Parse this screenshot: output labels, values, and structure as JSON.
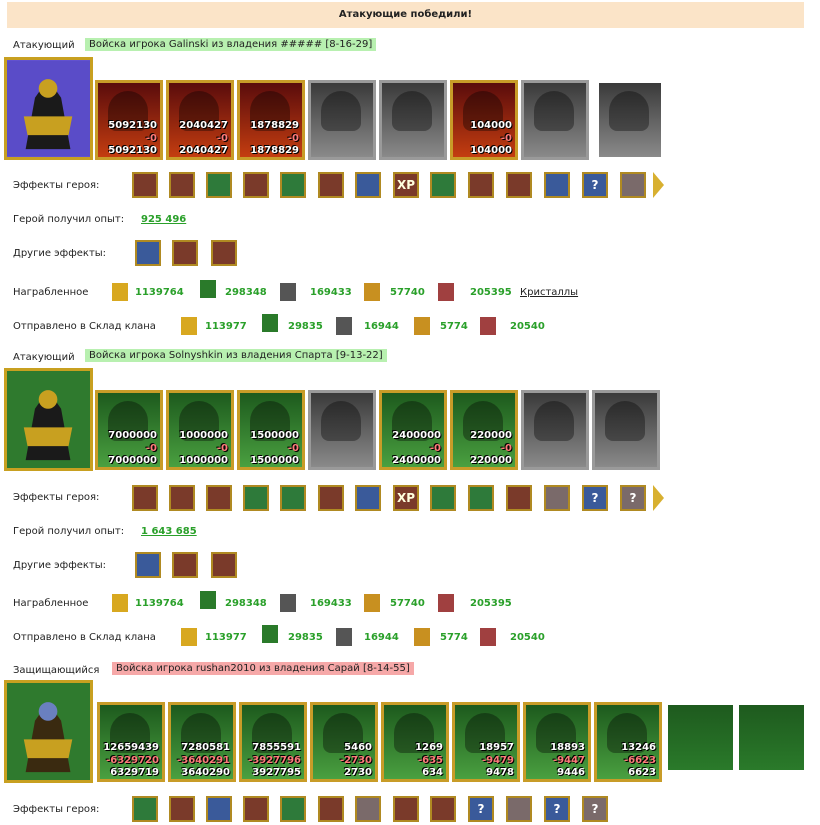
{
  "banner": "Атакующие победили!",
  "sections": [
    {
      "role": "Атакующий",
      "army": "Войска игрока Galinski из владения ##### [8-16-29]",
      "effects_label": "Эффекты героя:",
      "exp_label": "Герой получил опыт:",
      "exp_value": "925 496",
      "other_label": "Другие эффекты:",
      "reward_label": "Награбленное",
      "clan_label": "Отправлено в Склад клана",
      "rewards": [
        "1139764",
        "298348",
        "169433",
        "57740",
        "205395"
      ],
      "crystals_link": "Кристаллы",
      "clan": [
        "113977",
        "29835",
        "16944",
        "5774",
        "20540"
      ],
      "units": [
        {
          "a": "5092130",
          "b": "-0",
          "c": "5092130"
        },
        {
          "a": "2040427",
          "b": "-0",
          "c": "2040427"
        },
        {
          "a": "1878829",
          "b": "-0",
          "c": "1878829"
        },
        {
          "a": "",
          "b": "",
          "c": ""
        },
        {
          "a": "",
          "b": "",
          "c": ""
        },
        {
          "a": "104000",
          "b": "-0",
          "c": "104000"
        },
        {
          "a": "",
          "b": "",
          "c": ""
        }
      ]
    },
    {
      "role": "Атакующий",
      "army": "Войска игрока Solnyshkin из владения Спарта [9-13-22]",
      "effects_label": "Эффекты героя:",
      "exp_label": "Герой получил опыт:",
      "exp_value": "1 643 685",
      "other_label": "Другие эффекты:",
      "reward_label": "Награбленное",
      "clan_label": "Отправлено в Склад клана",
      "rewards": [
        "1139764",
        "298348",
        "169433",
        "57740",
        "205395"
      ],
      "clan": [
        "113977",
        "29835",
        "16944",
        "5774",
        "20540"
      ],
      "units": [
        {
          "a": "7000000",
          "b": "-0",
          "c": "7000000"
        },
        {
          "a": "1000000",
          "b": "-0",
          "c": "1000000"
        },
        {
          "a": "1500000",
          "b": "-0",
          "c": "1500000"
        },
        {
          "a": "",
          "b": "",
          "c": ""
        },
        {
          "a": "2400000",
          "b": "-0",
          "c": "2400000"
        },
        {
          "a": "220000",
          "b": "-0",
          "c": "220000"
        },
        {
          "a": "",
          "b": "",
          "c": ""
        },
        {
          "a": "",
          "b": "",
          "c": ""
        }
      ]
    },
    {
      "role": "Защищающийся",
      "army": "Войска игрока rushan2010 из владения Сарай [8-14-55]",
      "effects_label": "Эффекты героя:",
      "units": [
        {
          "a": "12659439",
          "b": "-6329720",
          "c": "6329719"
        },
        {
          "a": "7280581",
          "b": "-3640291",
          "c": "3640290"
        },
        {
          "a": "7855591",
          "b": "-3927796",
          "c": "3927795"
        },
        {
          "a": "5460",
          "b": "-2730",
          "c": "2730"
        },
        {
          "a": "1269",
          "b": "-635",
          "c": "634"
        },
        {
          "a": "18957",
          "b": "-9479",
          "c": "9478"
        },
        {
          "a": "18893",
          "b": "-9447",
          "c": "9446"
        },
        {
          "a": "13246",
          "b": "-6623",
          "c": "6623"
        }
      ]
    }
  ],
  "icons": {
    "xp": "XP",
    "question": "?"
  }
}
